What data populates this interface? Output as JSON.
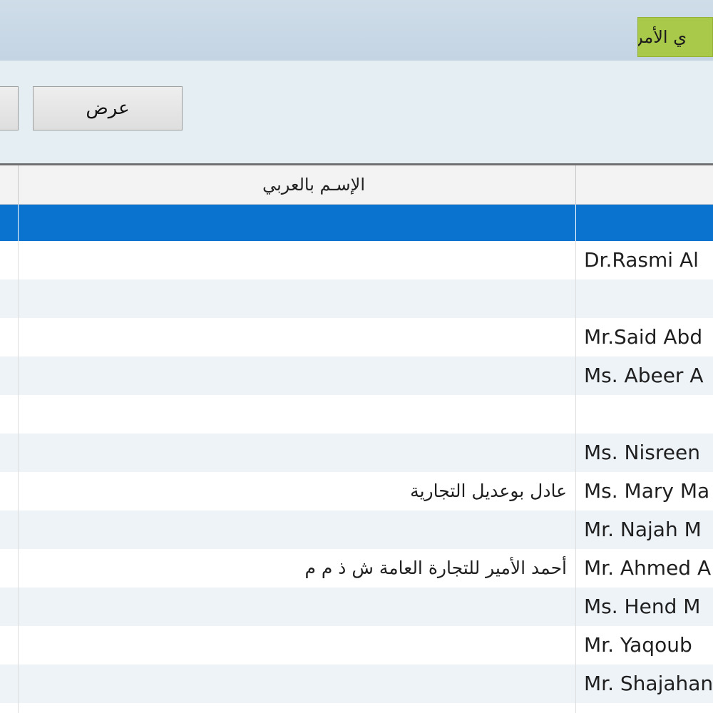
{
  "window": {
    "title_partial": "ي الأمر"
  },
  "toolbar": {
    "view_button": "عرض"
  },
  "grid": {
    "columns": [
      {
        "key": "arabic_name",
        "label": "الإسـم بالعربي"
      },
      {
        "key": "english_name",
        "label": ""
      }
    ],
    "rows": [
      {
        "arabic_name": "",
        "english_name": ""
      },
      {
        "arabic_name": "",
        "english_name": "Dr.Rasmi Al"
      },
      {
        "arabic_name": "",
        "english_name": ""
      },
      {
        "arabic_name": "",
        "english_name": "Mr.Said Abd"
      },
      {
        "arabic_name": "",
        "english_name": "Ms. Abeer A"
      },
      {
        "arabic_name": "",
        "english_name": ""
      },
      {
        "arabic_name": "",
        "english_name": "Ms. Nisreen"
      },
      {
        "arabic_name": "عادل بوعديل التجارية",
        "english_name": "Ms. Mary Ma"
      },
      {
        "arabic_name": "",
        "english_name": "Mr. Najah M"
      },
      {
        "arabic_name": "أحمد الأمير للتجارة العامة ش ذ م م",
        "english_name": "Mr. Ahmed A"
      },
      {
        "arabic_name": "",
        "english_name": "Ms. Hend M"
      },
      {
        "arabic_name": "",
        "english_name": "Mr. Yaqoub"
      },
      {
        "arabic_name": "",
        "english_name": "Mr. Shajahan"
      },
      {
        "arabic_name": "",
        "english_name": ""
      }
    ],
    "selected_row": 0
  },
  "colors": {
    "selection": "#0a72cf",
    "title_badge": "#a9c94a",
    "toolbar_bg": "#e5eff3"
  }
}
